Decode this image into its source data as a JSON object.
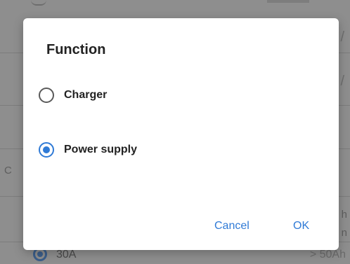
{
  "background": {
    "items": [
      {
        "text": "/"
      },
      {
        "text": "/"
      },
      {
        "text": "C"
      },
      {
        "text": "h"
      },
      {
        "text": "n"
      }
    ],
    "last_row": {
      "label": "30A",
      "value": "> 50Ah"
    }
  },
  "dialog": {
    "title": "Function",
    "options": [
      {
        "label": "Charger",
        "selected": false
      },
      {
        "label": "Power supply",
        "selected": true
      }
    ],
    "cancel_label": "Cancel",
    "ok_label": "OK"
  },
  "colors": {
    "accent": "#2f7ad6",
    "scrim": "#8e8e8e",
    "dialog_bg": "#ffffff"
  }
}
